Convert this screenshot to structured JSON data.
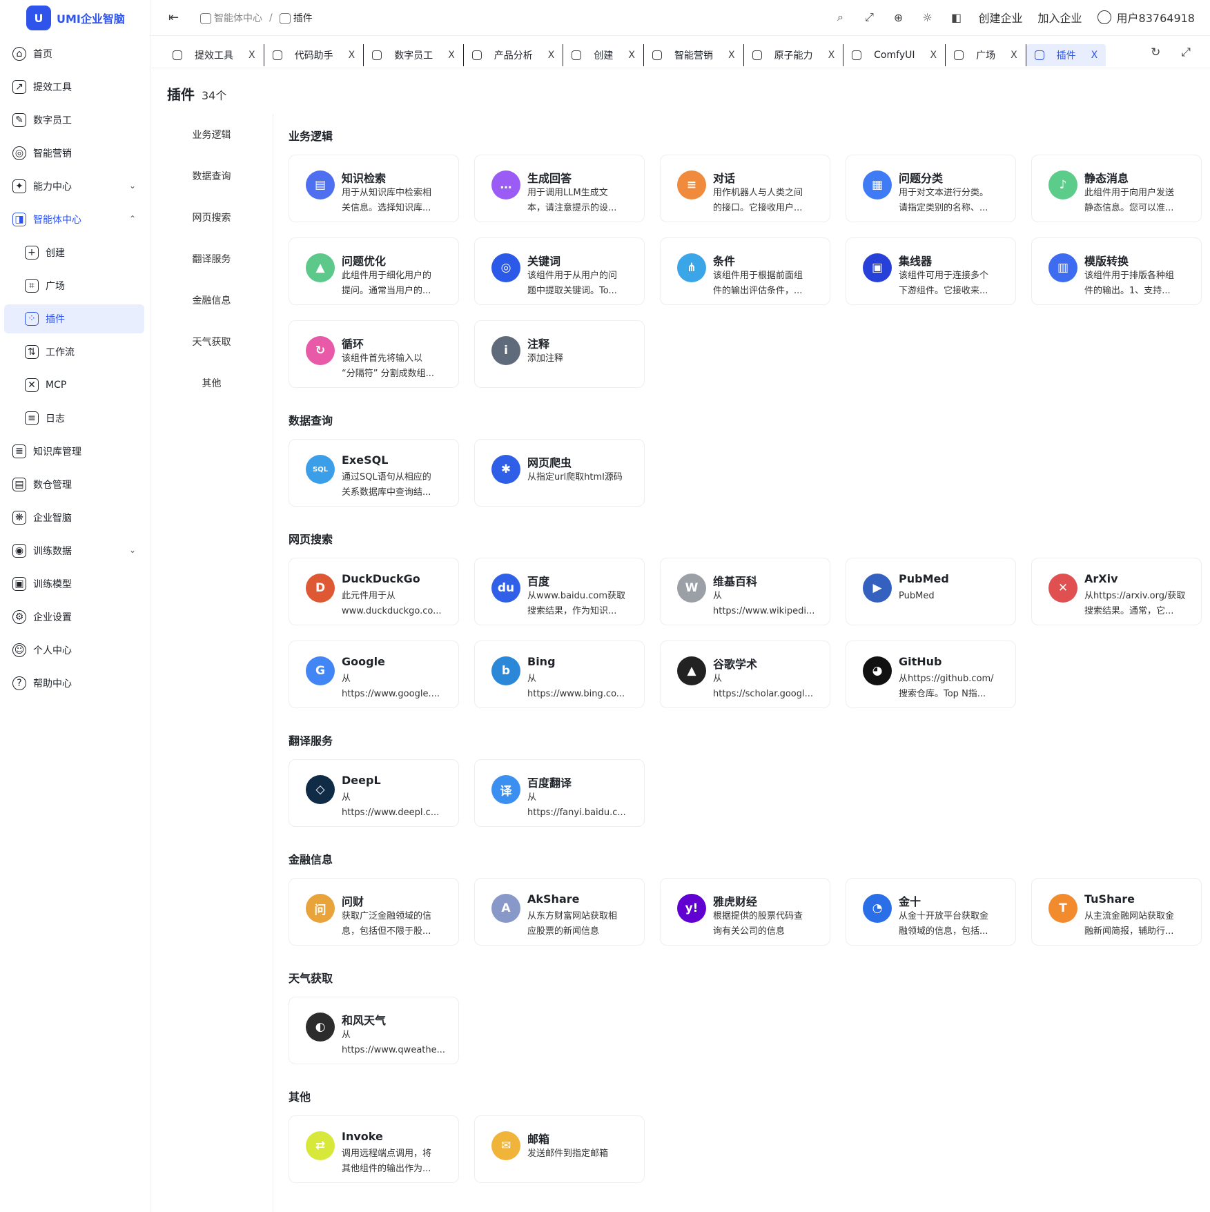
{
  "app": {
    "logo_mark": "U",
    "name": "UMI企业智脑"
  },
  "sidebar": {
    "items": [
      {
        "label": "首页",
        "icon": "home-icon",
        "glyph": "⌂"
      },
      {
        "label": "提效工具",
        "icon": "tools-icon",
        "glyph": "↗"
      },
      {
        "label": "数字员工",
        "icon": "digital-staff-icon",
        "glyph": "✎"
      },
      {
        "label": "智能营销",
        "icon": "target-icon",
        "glyph": "◎"
      },
      {
        "label": "能力中心",
        "icon": "ability-icon",
        "glyph": "✦",
        "chevron": "⌄"
      },
      {
        "label": "智能体中心",
        "icon": "agent-icon",
        "glyph": "◨",
        "chevron": "⌃"
      },
      {
        "label": "创建",
        "icon": "plus-circle-icon",
        "glyph": "+"
      },
      {
        "label": "广场",
        "icon": "plaza-icon",
        "glyph": "⌗"
      },
      {
        "label": "插件",
        "icon": "plugin-icon",
        "glyph": "⁘"
      },
      {
        "label": "工作流",
        "icon": "workflow-icon",
        "glyph": "⇅"
      },
      {
        "label": "MCP",
        "icon": "mcp-icon",
        "glyph": "✕"
      },
      {
        "label": "日志",
        "icon": "log-icon",
        "glyph": "≡"
      },
      {
        "label": "知识库管理",
        "icon": "knowledge-icon",
        "glyph": "≣"
      },
      {
        "label": "数仓管理",
        "icon": "warehouse-icon",
        "glyph": "▤"
      },
      {
        "label": "企业智脑",
        "icon": "brain-icon",
        "glyph": "❋"
      },
      {
        "label": "训练数据",
        "icon": "train-data-icon",
        "glyph": "◉",
        "chevron": "⌄"
      },
      {
        "label": "训练模型",
        "icon": "model-icon",
        "glyph": "▣"
      },
      {
        "label": "企业设置",
        "icon": "settings-icon",
        "glyph": "⚙"
      },
      {
        "label": "个人中心",
        "icon": "user-icon",
        "glyph": "☺"
      },
      {
        "label": "帮助中心",
        "icon": "help-icon",
        "glyph": "?"
      }
    ]
  },
  "topbar": {
    "collapse_glyph": "⇤",
    "breadcrumb": [
      "智能体中心",
      "/",
      "插件"
    ],
    "icons": [
      {
        "name": "search-icon",
        "glyph": "⌕"
      },
      {
        "name": "fullscreen-icon",
        "glyph": "⤢"
      },
      {
        "name": "language-icon",
        "glyph": "⊕"
      },
      {
        "name": "theme-icon",
        "glyph": "☼"
      },
      {
        "name": "layout-icon",
        "glyph": "◧"
      }
    ],
    "create_enterprise": "创建企业",
    "join_enterprise": "加入企业",
    "user": "用户83764918"
  },
  "tabs": {
    "items": [
      "提效工具",
      "代码助手",
      "数字员工",
      "产品分析",
      "创建",
      "智能营销",
      "原子能力",
      "ComfyUI",
      "广场",
      "插件"
    ],
    "close_glyph": "X",
    "refresh_glyph": "↻",
    "expand_glyph": "⤢"
  },
  "page": {
    "title": "插件",
    "count": "34个"
  },
  "categories": [
    "业务逻辑",
    "数据查询",
    "网页搜索",
    "翻译服务",
    "金融信息",
    "天气获取",
    "其他"
  ],
  "sections": [
    {
      "title": "业务逻辑",
      "cards": [
        {
          "name": "知识检索",
          "desc": [
            "用于从知识库中检索相",
            "关信息。选择知识库..."
          ],
          "color": "#4d6ff0",
          "glyph": "▤"
        },
        {
          "name": "生成回答",
          "desc": [
            "用于调用LLM生成文",
            "本，请注意提示的设..."
          ],
          "color": "#9b5cf6",
          "glyph": "…"
        },
        {
          "name": "对话",
          "desc": [
            "用作机器人与人类之间",
            "的接口。它接收用户..."
          ],
          "color": "#f08a3c",
          "glyph": "≡"
        },
        {
          "name": "问题分类",
          "desc": [
            "用于对文本进行分类。",
            "请指定类别的名称、..."
          ],
          "color": "#3f7bf5",
          "glyph": "▦"
        },
        {
          "name": "静态消息",
          "desc": [
            "此组件用于向用户发送",
            "静态信息。您可以准..."
          ],
          "color": "#5ccc8a",
          "glyph": "♪"
        },
        {
          "name": "问题优化",
          "desc": [
            "此组件用于细化用户的",
            "提问。通常当用户的..."
          ],
          "color": "#5cc98a",
          "glyph": "▲"
        },
        {
          "name": "关键词",
          "desc": [
            "该组件用于从用户的问",
            "题中提取关键词。To..."
          ],
          "color": "#2b59e8",
          "glyph": "◎"
        },
        {
          "name": "条件",
          "desc": [
            "该组件用于根据前面组",
            "件的输出评估条件，..."
          ],
          "color": "#3aa6e8",
          "glyph": "⋔"
        },
        {
          "name": "集线器",
          "desc": [
            "该组件可用于连接多个",
            "下游组件。它接收来..."
          ],
          "color": "#2741d8",
          "glyph": "▣"
        },
        {
          "name": "模版转换",
          "desc": [
            "该组件用于排版各种组",
            "件的输出。1、支持..."
          ],
          "color": "#3d6cf0",
          "glyph": "▥"
        },
        {
          "name": "循环",
          "desc": [
            "该组件首先将输入以",
            "“分隔符” 分割成数组..."
          ],
          "color": "#e85aa8",
          "glyph": "↻"
        },
        {
          "name": "注释",
          "desc": [
            "添加注释"
          ],
          "color": "#5f6b7a",
          "glyph": "i"
        }
      ]
    },
    {
      "title": "数据查询",
      "cards": [
        {
          "name": "ExeSQL",
          "desc": [
            "通过SQL语句从相应的",
            "关系数据库中查询结..."
          ],
          "color": "#3a9ee8",
          "glyph": "SQL"
        },
        {
          "name": "网页爬虫",
          "desc": [
            "从指定url爬取html源码"
          ],
          "color": "#2f5fe6",
          "glyph": "✱"
        }
      ]
    },
    {
      "title": "网页搜索",
      "cards": [
        {
          "name": "DuckDuckGo",
          "desc": [
            "此元件用于从",
            "www.duckduckgo.co..."
          ],
          "color": "#de5833",
          "glyph": "D"
        },
        {
          "name": "百度",
          "desc": [
            "从www.baidu.com获取",
            "搜索结果，作为知识..."
          ],
          "color": "#3060e8",
          "glyph": "du"
        },
        {
          "name": "维基百科",
          "desc": [
            "从",
            "https://www.wikipedi..."
          ],
          "color": "#9aa0a6",
          "glyph": "W"
        },
        {
          "name": "PubMed",
          "desc": [
            "PubMed"
          ],
          "color": "#3460c0",
          "glyph": "▶"
        },
        {
          "name": "ArXiv",
          "desc": [
            "从https://arxiv.org/获取",
            "搜索结果。通常，它..."
          ],
          "color": "#e05050",
          "glyph": "✕"
        },
        {
          "name": "Google",
          "desc": [
            "从",
            "https://www.google...."
          ],
          "color": "#4285f4",
          "glyph": "G"
        },
        {
          "name": "Bing",
          "desc": [
            "从",
            "https://www.bing.co..."
          ],
          "color": "#2b88d8",
          "glyph": "b"
        },
        {
          "name": "谷歌学术",
          "desc": [
            "从",
            "https://scholar.googl..."
          ],
          "color": "#222222",
          "glyph": "▲"
        },
        {
          "name": "GitHub",
          "desc": [
            "从https://github.com/",
            "搜索仓库。Top N指..."
          ],
          "color": "#111111",
          "glyph": "◕"
        }
      ]
    },
    {
      "title": "翻译服务",
      "cards": [
        {
          "name": "DeepL",
          "desc": [
            "从",
            "https://www.deepl.c..."
          ],
          "color": "#0f2b46",
          "glyph": "◇"
        },
        {
          "name": "百度翻译",
          "desc": [
            "从",
            "https://fanyi.baidu.c..."
          ],
          "color": "#3b8ff0",
          "glyph": "译"
        }
      ]
    },
    {
      "title": "金融信息",
      "cards": [
        {
          "name": "问财",
          "desc": [
            "获取广泛金融领域的信",
            "息，包括但不限于股..."
          ],
          "color": "#e8a33a",
          "glyph": "问"
        },
        {
          "name": "AkShare",
          "desc": [
            "从东方财富网站获取相",
            "应股票的新闻信息"
          ],
          "color": "#8898c8",
          "glyph": "A"
        },
        {
          "name": "雅虎财经",
          "desc": [
            "根据提供的股票代码查",
            "询有关公司的信息"
          ],
          "color": "#6001d2",
          "glyph": "y!"
        },
        {
          "name": "金十",
          "desc": [
            "从金十开放平台获取金",
            "融领域的信息，包括..."
          ],
          "color": "#2a6ee8",
          "glyph": "◔"
        },
        {
          "name": "TuShare",
          "desc": [
            "从主流金融网站获取金",
            "融新闻简报，辅助行..."
          ],
          "color": "#f28a2e",
          "glyph": "T"
        }
      ]
    },
    {
      "title": "天气获取",
      "cards": [
        {
          "name": "和风天气",
          "desc": [
            "从",
            "https://www.qweathe..."
          ],
          "color": "#2c2c2c",
          "glyph": "◐"
        }
      ]
    },
    {
      "title": "其他",
      "cards": [
        {
          "name": "Invoke",
          "desc": [
            "调用远程端点调用，将",
            "其他组件的输出作为..."
          ],
          "color": "#d8e83a",
          "glyph": "⇄"
        },
        {
          "name": "邮箱",
          "desc": [
            "发送邮件到指定邮箱"
          ],
          "color": "#f0b43a",
          "glyph": "✉"
        }
      ]
    }
  ],
  "colors": {
    "accent": "#2f54eb",
    "active_bg": "#e8eefe",
    "border": "#eceef2"
  }
}
